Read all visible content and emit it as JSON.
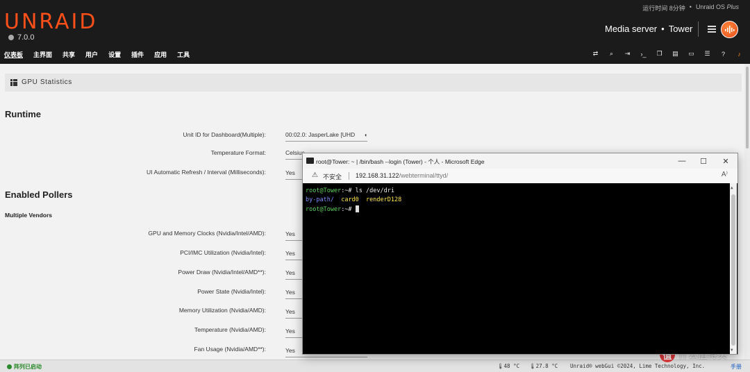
{
  "header": {
    "logo": "UNRAID",
    "version": "7.0.0",
    "uptime": "运行时间 8分钟",
    "bullet": "•",
    "os_name": "Unraid OS",
    "os_plus": "Plus",
    "server_desc": "Media server",
    "server_bullet": "•",
    "server_name": "Tower",
    "nav": [
      "仪表板",
      "主界面",
      "共享",
      "用户",
      "设置",
      "插件",
      "应用",
      "工具"
    ],
    "tools": [
      "switch-icon",
      "search-icon",
      "logout-icon",
      "terminal-icon",
      "copy-icon",
      "log-icon",
      "monitor-icon",
      "list-icon",
      "help-icon",
      "bell-icon"
    ]
  },
  "panel": {
    "title": "GPU Statistics"
  },
  "runtime": {
    "heading": "Runtime",
    "rows": [
      {
        "label": "Unit ID for Dashboard(Multiple):",
        "value": "00:02.0: JasperLake [UHD"
      },
      {
        "label": "Temperature Format:",
        "value": "Celsius"
      },
      {
        "label": "UI Automatic Refresh / Interval (Milliseconds):",
        "value": "Yes"
      }
    ]
  },
  "pollers": {
    "heading": "Enabled Pollers",
    "subheading": "Multiple Vendors",
    "rows": [
      {
        "label": "GPU and Memory Clocks (Nvidia/Intel/AMD):",
        "value": "Yes"
      },
      {
        "label": "PCI/IMC Utilization (Nvidia/Intel):",
        "value": "Yes"
      },
      {
        "label": "Power Draw (Nvidia/Intel/AMD**):",
        "value": "Yes"
      },
      {
        "label": "Power State (Nvidia/Intel):",
        "value": "Yes"
      },
      {
        "label": "Memory Utilization (Nvidia/AMD):",
        "value": "Yes"
      },
      {
        "label": "Temperature (Nvidia/AMD):",
        "value": "Yes"
      },
      {
        "label": "Fan Usage (Nvidia/AMD**):",
        "value": "Yes"
      }
    ]
  },
  "footer": {
    "array_status": "阵列已启动",
    "temp1": "48 °C",
    "temp2": "27.8 °C",
    "copyright": "Unraid® webGui ©2024, Lime Technology, Inc.",
    "manual": "手册"
  },
  "watermark": {
    "icon": "值",
    "text": "什么值得买"
  },
  "browser": {
    "title": "root@Tower: ~ | /bin/bash --login (Tower) - 个人 - Microsoft Edge",
    "minimize": "—",
    "maximize": "☐",
    "close": "✕",
    "insecure": "不安全",
    "url_host": "192.168.31.122",
    "url_path": "/webterminal/ttyd/",
    "read_aloud": "A⁾"
  },
  "terminal": {
    "prompt_user": "root@Tower",
    "prompt_path": ":~#",
    "command": " ls /dev/dri",
    "out_dir": "by-path/",
    "out_card": "card0",
    "out_render": "renderD128"
  }
}
